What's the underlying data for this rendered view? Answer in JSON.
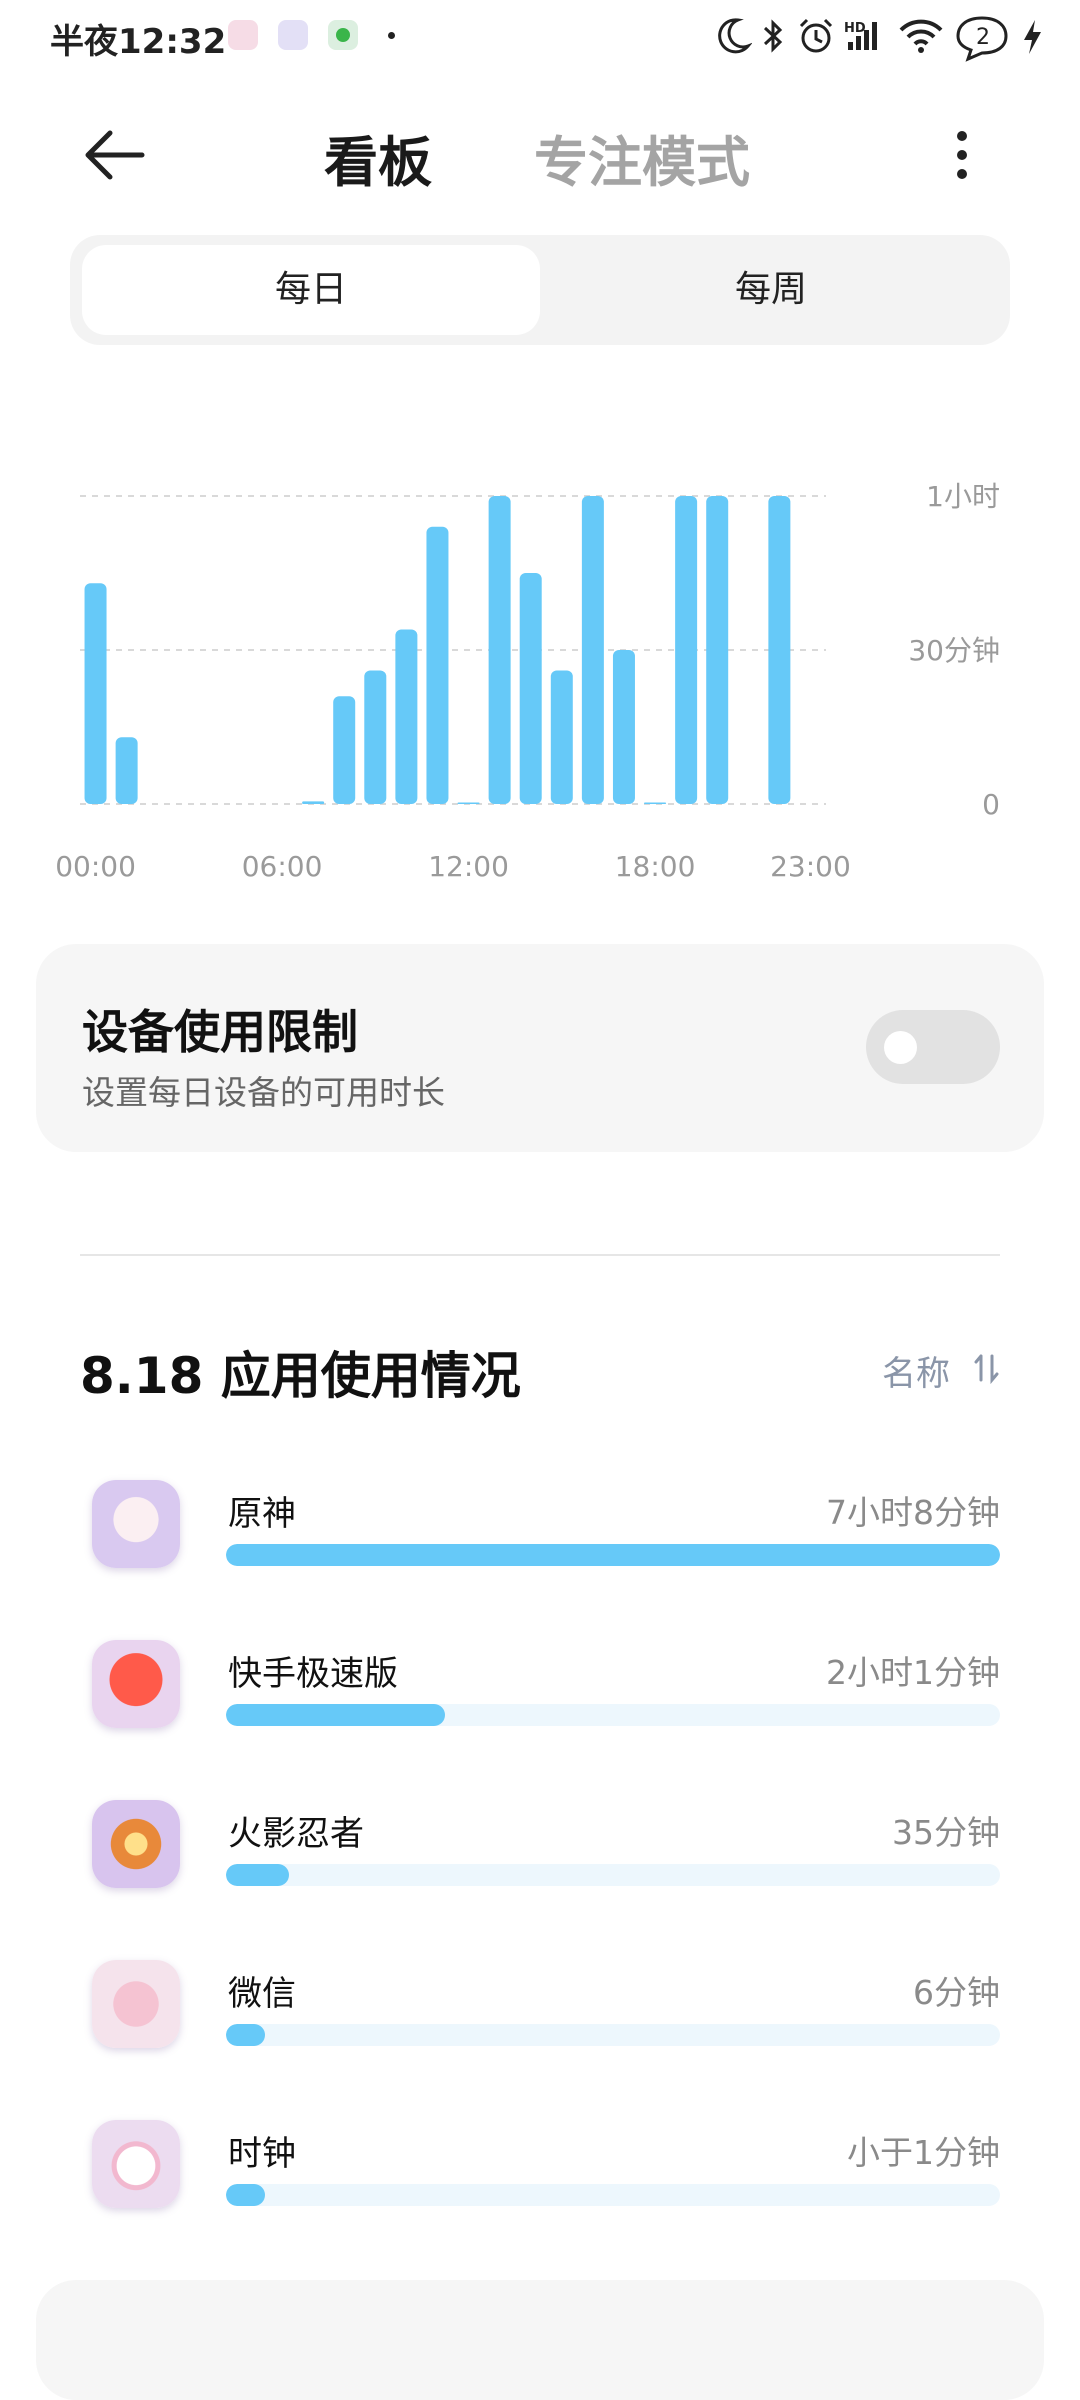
{
  "status_bar": {
    "time": "半夜12:32",
    "notification_icons": [
      "app-notification-icon",
      "chat-notification-icon",
      "wechat-notification-icon"
    ],
    "indicator_icons": [
      "moon-icon",
      "bluetooth-icon",
      "alarm-icon",
      "signal-icon",
      "wifi-icon",
      "message-bubble-icon",
      "charging-icon"
    ],
    "bubble_count": "2",
    "network_label": "HD"
  },
  "header": {
    "back_icon": "back-arrow-icon",
    "tabs": [
      {
        "label": "看板",
        "active": true
      },
      {
        "label": "专注模式",
        "active": false
      }
    ],
    "more_icon": "more-vertical-icon"
  },
  "segmented": {
    "options": [
      {
        "label": "每日",
        "selected": true
      },
      {
        "label": "每周",
        "selected": false
      }
    ]
  },
  "chart_data": {
    "type": "bar",
    "unit": "minutes",
    "x": [
      0,
      1,
      2,
      3,
      4,
      5,
      6,
      7,
      8,
      9,
      10,
      11,
      12,
      13,
      14,
      15,
      16,
      17,
      18,
      19,
      20,
      21,
      22,
      23
    ],
    "values": [
      43,
      13,
      0,
      0,
      0,
      0,
      0,
      0.5,
      21,
      26,
      34,
      54,
      0.3,
      60,
      45,
      26,
      60,
      30,
      0.3,
      60,
      60,
      0,
      60,
      0
    ],
    "x_tick_labels": [
      "00:00",
      "06:00",
      "12:00",
      "18:00",
      "23:00"
    ],
    "x_tick_hours": [
      0,
      6,
      12,
      18,
      23
    ],
    "y_tick_labels": [
      "1小时",
      "30分钟",
      "0"
    ],
    "y_tick_values": [
      60,
      30,
      0
    ],
    "ylim": [
      0,
      60
    ],
    "grid": true,
    "bar_color": "#66c9f8"
  },
  "device_limit": {
    "title": "设备使用限制",
    "subtitle": "设置每日设备的可用时长",
    "toggle_on": false
  },
  "usage": {
    "title": "8.18 应用使用情况",
    "sort_label": "名称",
    "sort_icon": "sort-icon",
    "apps": [
      {
        "name": "原神",
        "time": "7小时8分钟",
        "fraction": 1.0,
        "icon": "genshin-app-icon"
      },
      {
        "name": "快手极速版",
        "time": "2小时1分钟",
        "fraction": 0.283,
        "icon": "kuaishou-app-icon"
      },
      {
        "name": "火影忍者",
        "time": "35分钟",
        "fraction": 0.082,
        "icon": "naruto-app-icon"
      },
      {
        "name": "微信",
        "time": "6分钟",
        "fraction": 0.014,
        "icon": "wechat-app-icon"
      },
      {
        "name": "时钟",
        "time": "小于1分钟",
        "fraction": 0.002,
        "icon": "clock-app-icon"
      }
    ]
  },
  "colors": {
    "accent": "#66c9f8",
    "track": "#edf7fd",
    "card_bg": "#f6f6f6"
  }
}
